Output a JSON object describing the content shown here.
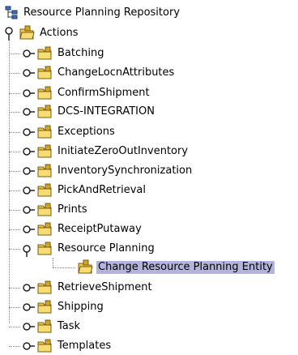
{
  "tree": {
    "root": {
      "label": "Resource Planning Repository",
      "icon": "repository-icon"
    },
    "actions": {
      "label": "Actions",
      "icon": "folder-open-icon",
      "expanded": true
    },
    "children": [
      {
        "label": "Batching",
        "expanded": false
      },
      {
        "label": "ChangeLocnAttributes",
        "expanded": false
      },
      {
        "label": "ConfirmShipment",
        "expanded": false
      },
      {
        "label": "DCS-INTEGRATION",
        "expanded": false
      },
      {
        "label": "Exceptions",
        "expanded": false
      },
      {
        "label": "InitiateZeroOutInventory",
        "expanded": false
      },
      {
        "label": "InventorySynchronization",
        "expanded": false
      },
      {
        "label": "PickAndRetrieval",
        "expanded": false
      },
      {
        "label": "Prints",
        "expanded": false
      },
      {
        "label": "ReceiptPutaway",
        "expanded": false
      },
      {
        "label": "Resource Planning",
        "expanded": true
      },
      {
        "label": "RetrieveShipment",
        "expanded": false
      },
      {
        "label": "Shipping",
        "expanded": false
      },
      {
        "label": "Task",
        "expanded": false
      },
      {
        "label": "Templates",
        "expanded": false
      }
    ],
    "selected_child": {
      "label": "Change Resource Planning Entity",
      "icon": "action-item-icon",
      "selected": true
    }
  },
  "colors": {
    "selection": "#b3b3dd",
    "folder_yellow": "#f2c94c",
    "folder_dark": "#9c7a12",
    "connector": "#8a8a8a"
  }
}
